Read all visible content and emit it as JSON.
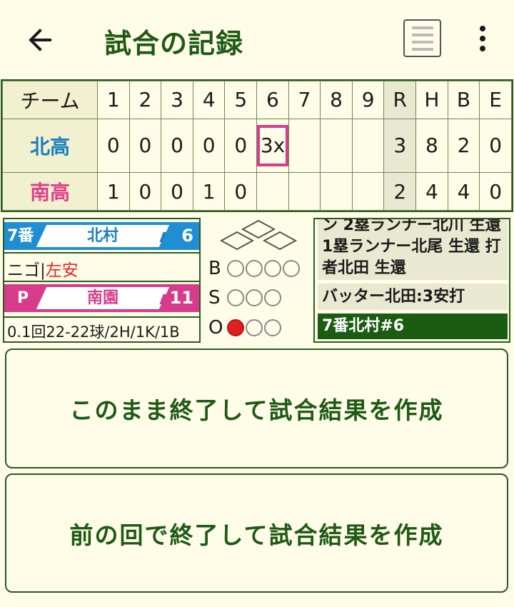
{
  "header": {
    "back_icon": "arrow-left-icon",
    "title": "試合の記録",
    "list_icon": "list-icon",
    "more_icon": "more-vertical-icon"
  },
  "scoreboard": {
    "team_header": "チーム",
    "innings": [
      "1",
      "2",
      "3",
      "4",
      "5",
      "6",
      "7",
      "8",
      "9"
    ],
    "rhe": [
      "R",
      "H",
      "B",
      "E"
    ],
    "teams": [
      {
        "name": "北高",
        "scores": [
          "0",
          "0",
          "0",
          "0",
          "0",
          "3x",
          "",
          "",
          ""
        ],
        "r": "3",
        "h": "8",
        "b": "2",
        "e": "0"
      },
      {
        "name": "南高",
        "scores": [
          "1",
          "0",
          "0",
          "1",
          "0",
          "",
          "",
          "",
          ""
        ],
        "r": "2",
        "h": "4",
        "b": "4",
        "e": "0"
      }
    ],
    "colors": {
      "north": "#1a7fbf",
      "south": "#e0408a",
      "current_inning_border": "#d63c8a"
    }
  },
  "batter": {
    "order": "7番",
    "name": "北村",
    "number": "6",
    "result_prev": "ニゴ",
    "result_sep": "|",
    "result_current": "左安"
  },
  "pitcher": {
    "label": "P",
    "name": "南園",
    "number": "11",
    "stats": "0.1回22-22球/2H/1K/1B"
  },
  "count": {
    "balls_label": "B",
    "strikes_label": "S",
    "outs_label": "O",
    "balls": 0,
    "strikes": 0,
    "outs": 1,
    "bases_icon": "bases-diamond-icon"
  },
  "log": {
    "items": [
      "ン 2塁ランナー北川 生還 1塁ランナー北尾 生還 打者北田 生還",
      "バッター北田:3安打",
      "7番北村#6"
    ]
  },
  "actions": {
    "end_now": "このまま終了して試合結果を作成",
    "end_prev": "前の回で終了して試合結果を作成"
  }
}
